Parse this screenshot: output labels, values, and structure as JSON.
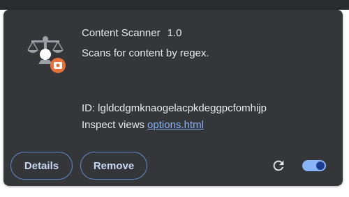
{
  "extension": {
    "name": "Content Scanner",
    "version": "1.0",
    "description": "Scans for content by regex.",
    "id_label": "ID:",
    "id_value": "lgldcdgmknaogelacpkdeggpcfomhijp",
    "inspect_label": "Inspect views",
    "inspect_link": "options.html",
    "icon": "scales-of-justice-with-badge-icon",
    "enabled": true
  },
  "buttons": {
    "details": "Details",
    "remove": "Remove"
  },
  "controls": {
    "reload_icon": "reload-icon",
    "toggle_state": "on"
  },
  "colors": {
    "card_background": "#35363a",
    "text": "#e8eaed",
    "link": "#8ab4f8",
    "button_border": "#5f8cc9",
    "toggle_track": "#8ab4f8",
    "toggle_knob": "#1a3d8f",
    "badge": "#e8703a"
  }
}
